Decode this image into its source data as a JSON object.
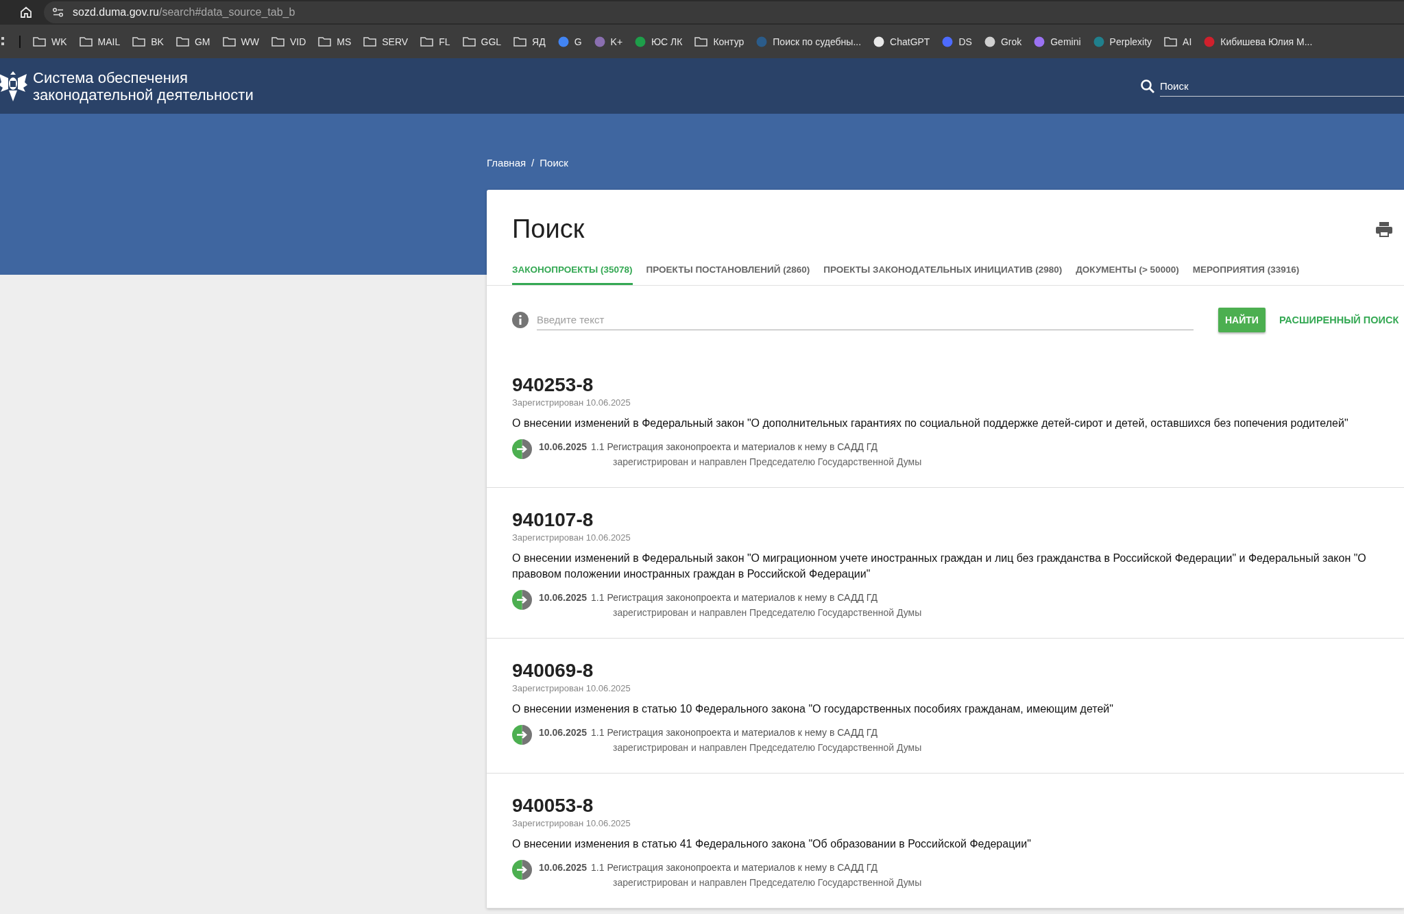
{
  "browser": {
    "url_host": "sozd.duma.gov.ru",
    "url_path": "/search#data_source_tab_b",
    "bookmarks": [
      {
        "kind": "folder",
        "label": "WK"
      },
      {
        "kind": "folder",
        "label": "MAIL"
      },
      {
        "kind": "folder",
        "label": "BK"
      },
      {
        "kind": "folder",
        "label": "GM"
      },
      {
        "kind": "folder",
        "label": "WW"
      },
      {
        "kind": "folder",
        "label": "VID"
      },
      {
        "kind": "folder",
        "label": "MS"
      },
      {
        "kind": "folder",
        "label": "SERV"
      },
      {
        "kind": "folder",
        "label": "FL"
      },
      {
        "kind": "folder",
        "label": "GGL"
      },
      {
        "kind": "folder",
        "label": "ЯД"
      },
      {
        "kind": "favicon",
        "label": "G",
        "color": "#4285f4"
      },
      {
        "kind": "favicon",
        "label": "K+",
        "color": "#8a6fb0"
      },
      {
        "kind": "favicon",
        "label": "ЮС ЛК",
        "color": "#1e9e4a"
      },
      {
        "kind": "folder",
        "label": "Контур"
      },
      {
        "kind": "favicon",
        "label": "Поиск по судебны...",
        "color": "#2b5c8a"
      },
      {
        "kind": "favicon",
        "label": "ChatGPT",
        "color": "#e8e8e8"
      },
      {
        "kind": "favicon",
        "label": "DS",
        "color": "#4d6bfe"
      },
      {
        "kind": "favicon",
        "label": "Grok",
        "color": "#d0d0d0"
      },
      {
        "kind": "favicon",
        "label": "Gemini",
        "color": "#9b72f2"
      },
      {
        "kind": "favicon",
        "label": "Perplexity",
        "color": "#20808d"
      },
      {
        "kind": "folder",
        "label": "AI"
      },
      {
        "kind": "favicon",
        "label": "Кибишева Юлия М...",
        "color": "#d0202c"
      }
    ]
  },
  "site": {
    "title_line_1": "Система обеспечения",
    "title_line_2": "законодательной деятельности",
    "search": {
      "placeholder": "Поиск"
    }
  },
  "breadcrumb_separator": "/",
  "breadcrumbs": [
    {
      "label": "Главная"
    },
    {
      "label": "Поиск"
    }
  ],
  "page_title": "Поиск",
  "tabs": [
    {
      "label": "ЗАКОНОПРОЕКТЫ (35078)",
      "selected": true
    },
    {
      "label": "ПРОЕКТЫ ПОСТАНОВЛЕНИЙ (2860)",
      "selected": false
    },
    {
      "label": "ПРОЕКТЫ ЗАКОНОДАТЕЛЬНЫХ ИНИЦИАТИВ (2980)",
      "selected": false
    },
    {
      "label": "ДОКУМЕНТЫ (> 50000)",
      "selected": false
    },
    {
      "label": "МЕРОПРИЯТИЯ (33916)",
      "selected": false
    }
  ],
  "search": {
    "placeholder": "Введите текст",
    "button": "НАЙТИ",
    "advanced_link": "РАСШИРЕННЫЙ ПОИСК"
  },
  "results": [
    {
      "number": "940253-8",
      "registered": "Зарегистрирован 10.06.2025",
      "title": "О внесении изменений в Федеральный закон \"О дополнительных гарантиях по социальной поддержке детей-сирот и детей, оставшихся без попечения родителей\"",
      "status_date": "10.06.2025",
      "status_stage": "1.1 Регистрация законопроекта и материалов к нему в САДД ГД",
      "status_note": "зарегистрирован и направлен Председателю Государственной Думы"
    },
    {
      "number": "940107-8",
      "registered": "Зарегистрирован 10.06.2025",
      "title": "О внесении изменений в Федеральный закон \"О миграционном учете иностранных граждан и лиц без гражданства в Российской Федерации\" и Федеральный закон \"О правовом положении иностранных граждан в Российской Федерации\"",
      "status_date": "10.06.2025",
      "status_stage": "1.1 Регистрация законопроекта и материалов к нему в САДД ГД",
      "status_note": "зарегистрирован и направлен Председателю Государственной Думы"
    },
    {
      "number": "940069-8",
      "registered": "Зарегистрирован 10.06.2025",
      "title": "О внесении изменения в статью 10 Федерального закона \"О государственных пособиях гражданам, имеющим детей\"",
      "status_date": "10.06.2025",
      "status_stage": "1.1 Регистрация законопроекта и материалов к нему в САДД ГД",
      "status_note": "зарегистрирован и направлен Председателю Государственной Думы"
    },
    {
      "number": "940053-8",
      "registered": "Зарегистрирован 10.06.2025",
      "title": "О внесении изменения в статью 41 Федерального закона \"Об образовании в Российской Федерации\"",
      "status_date": "10.06.2025",
      "status_stage": "1.1 Регистрация законопроекта и материалов к нему в САДД ГД",
      "status_note": "зарегистрирован и направлен Председателю Государственной Думы"
    }
  ]
}
